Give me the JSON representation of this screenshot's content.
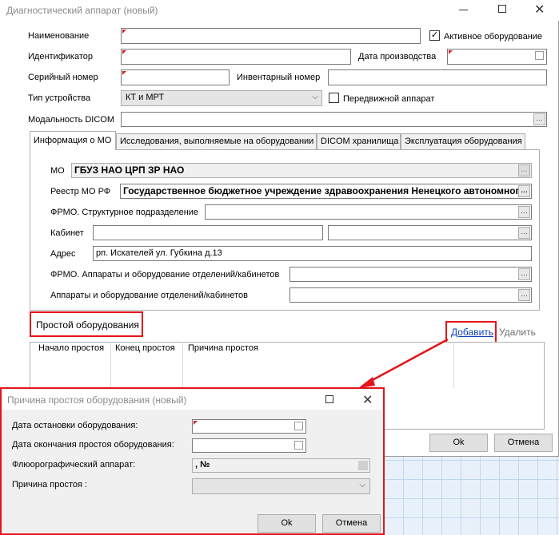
{
  "window": {
    "title": "Диагностический аппарат (новый)"
  },
  "form": {
    "name_label": "Наименование",
    "active_label": "Активное оборудование",
    "id_label": "Идентификатор",
    "prod_date_label": "Дата производства",
    "serial_label": "Серийный номер",
    "inventory_label": "Инвентарный номер",
    "device_type_label": "Тип устройства",
    "device_type_value": "КТ и МРТ",
    "mobile_label": "Передвижной аппарат",
    "dicom_label": "Модальность DICOM"
  },
  "tabs": [
    {
      "label": "Информация о МО"
    },
    {
      "label": "Исследования, выполняемые на оборудовании"
    },
    {
      "label": "DICOM хранилища"
    },
    {
      "label": "Эксплуатация оборудования"
    }
  ],
  "mo": {
    "mo_label": "МО",
    "mo_value": "ГБУЗ НАО ЦРП ЗР НАО",
    "registry_label": "Реестр МО РФ",
    "registry_value": "Государственное бюджетное учреждение здравоохранения Ненецкого автономного",
    "frmo_struct_label": "ФРМО. Структурное подразделение",
    "cabinet_label": "Кабинет",
    "address_label": "Адрес",
    "address_value": "рп. Искателей ул. Губкина д.13",
    "frmo_devices_label": "ФРМО. Аппараты и оборудование отделений/кабинетов",
    "devices_label": "Аппараты и оборудование отделений/кабинетов"
  },
  "downtime": {
    "title": "Простой оборудования",
    "add_label": "Добавить",
    "delete_label": "Удалить",
    "columns": [
      "Начало простоя",
      "Конец простоя",
      "Причина простоя"
    ]
  },
  "main_buttons": {
    "ok": "Ok",
    "cancel": "Отмена"
  },
  "dialog": {
    "title": "Причина простоя оборудования (новый)",
    "stop_date_label": "Дата остановки оборудования:",
    "end_date_label": "Дата окончания простоя оборудования:",
    "fluoro_label": "Флюорографический аппарат:",
    "fluoro_value": ", №",
    "reason_label": "Причина простоя :",
    "ok": "Ok",
    "cancel": "Отмена"
  },
  "colors": {
    "highlight": "#e3151a",
    "link": "#0b40b5"
  },
  "icons": [
    "minimize-icon",
    "maximize-icon",
    "close-icon",
    "ellipsis-icon",
    "calendar-icon",
    "chevron-down-icon",
    "checkmark-icon"
  ]
}
